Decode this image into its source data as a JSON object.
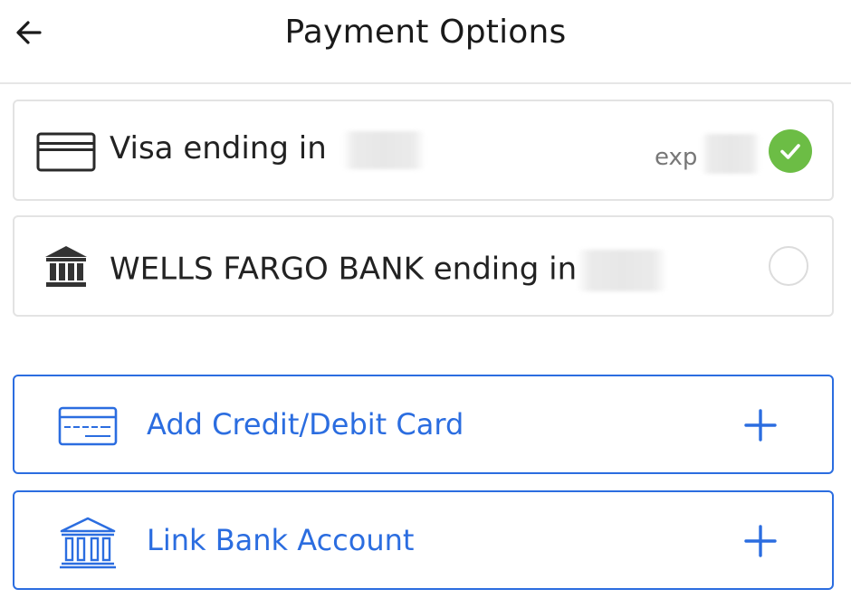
{
  "header": {
    "title": "Payment Options",
    "back_icon": "arrow-left-icon"
  },
  "payment_methods": [
    {
      "icon": "credit-card-icon",
      "label": "Visa ending in",
      "expiry_label": "exp",
      "selected": true,
      "status_icon": "check-circle-icon"
    },
    {
      "icon": "bank-icon",
      "label": "WELLS FARGO BANK ending in",
      "selected": false,
      "status_icon": "radio-unselected-icon"
    }
  ],
  "actions": {
    "add_card": {
      "label": "Add Credit/Debit Card",
      "icon": "credit-card-outline-icon",
      "trailing_icon": "plus-icon"
    },
    "link_bank": {
      "label": "Link Bank Account",
      "icon": "bank-outline-icon",
      "trailing_icon": "plus-icon"
    }
  },
  "colors": {
    "accent": "#2b6de0",
    "success": "#6cbd45",
    "text": "#1a1a1a",
    "border": "#e3e3e3"
  }
}
